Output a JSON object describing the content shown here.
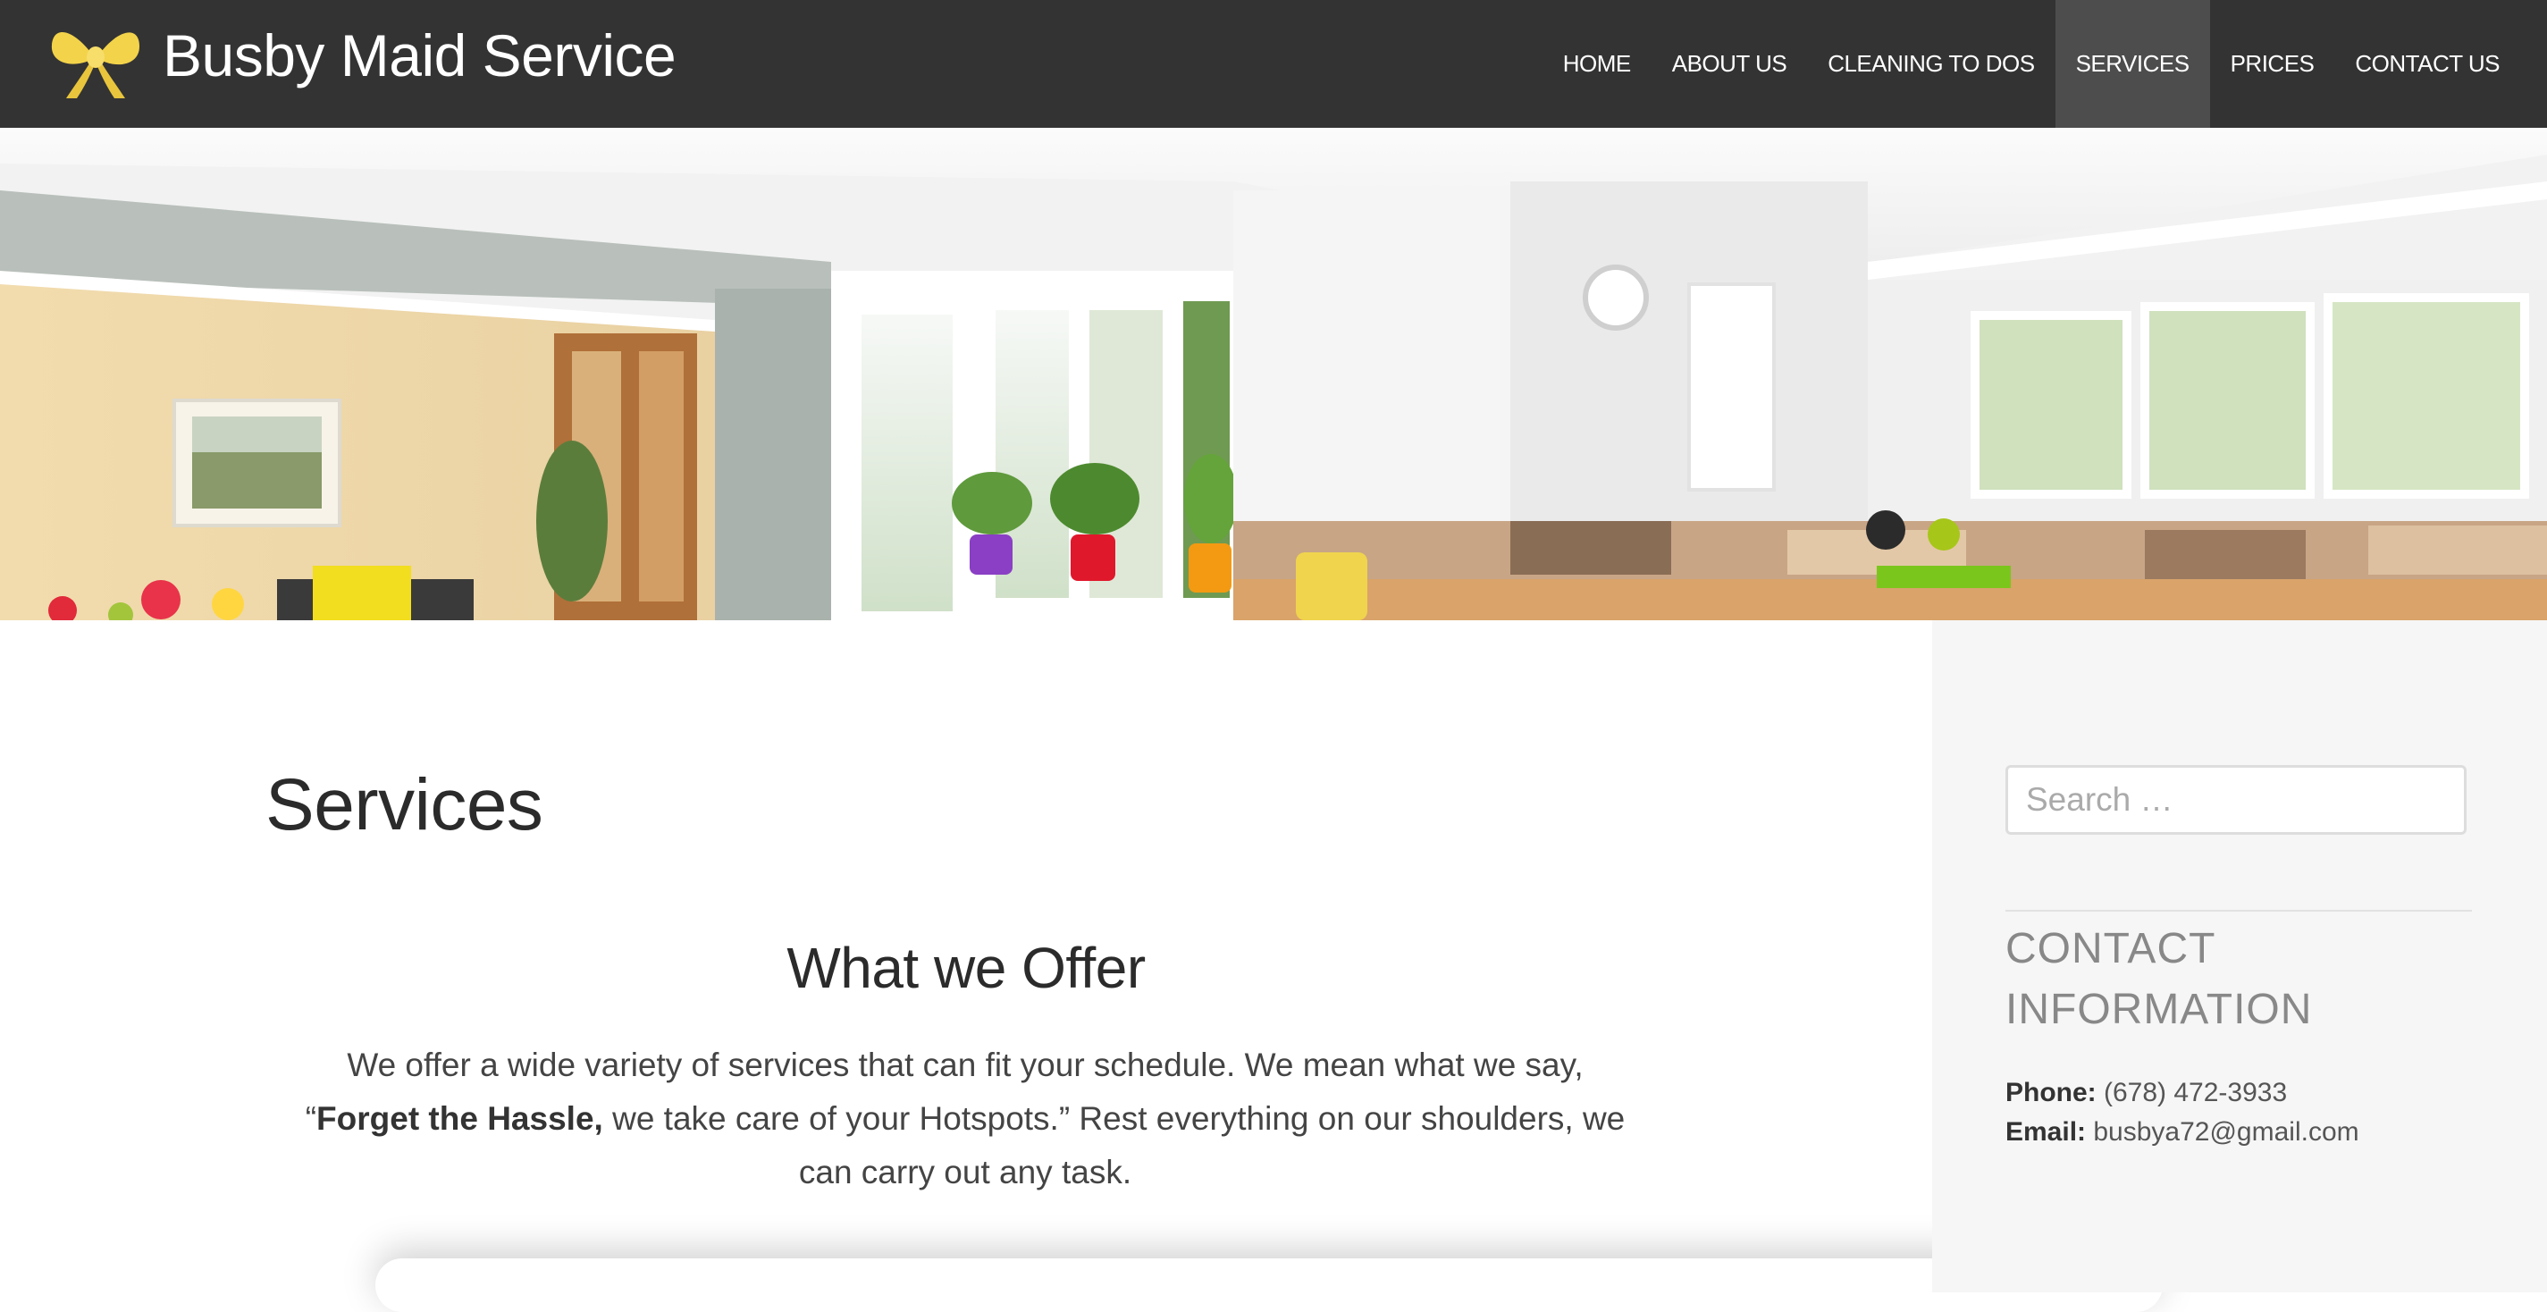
{
  "site": {
    "title": "Busby Maid Service",
    "logo_icon": "yellow-bow-icon",
    "accent_color": "#f3d34a",
    "header_bg": "#333333"
  },
  "nav": {
    "items": [
      {
        "label": "HOME"
      },
      {
        "label": "ABOUT US"
      },
      {
        "label": "CLEANING TO DOS"
      },
      {
        "label": "SERVICES"
      },
      {
        "label": "PRICES"
      },
      {
        "label": "CONTACT US"
      }
    ],
    "active": "SERVICES"
  },
  "main": {
    "page_title": "Services",
    "offer_heading": "What we Offer",
    "offer_text_1": "We offer a wide variety of services that can fit your schedule. We mean what we say,",
    "offer_quote_open": "“",
    "offer_bold": "Forget the Hassle,",
    "offer_text_2": " we take care of your Hotspots.” Rest everything on our shoulders, we can carry out any task."
  },
  "sidebar": {
    "search_placeholder": "Search …",
    "contact_title": "CONTACT INFORMATION",
    "phone_label": "Phone:",
    "phone_value": " (678) 472-3933",
    "email_label": "Email:",
    "email_value": " busbya72@gmail.com"
  }
}
